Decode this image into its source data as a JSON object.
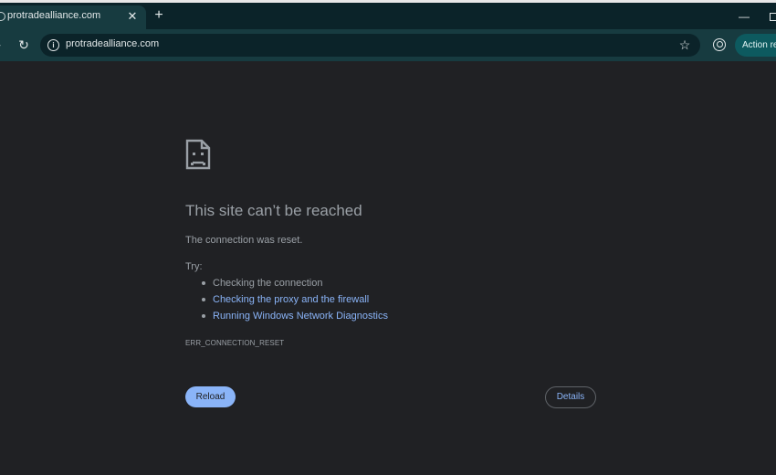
{
  "browser": {
    "tab": {
      "title": "protradealliance.com",
      "close_glyph": "✕"
    },
    "new_tab_glyph": "+",
    "window_controls": {
      "minimize_glyph": "—"
    },
    "toolbar": {
      "forward_glyph": "›",
      "reload_glyph": "↻",
      "url": "protradealliance.com",
      "site_info_glyph": "i",
      "bookmark_glyph": "☆",
      "action_button_label": "Action re"
    }
  },
  "error_page": {
    "headline": "This site can’t be reached",
    "description": "The connection was reset.",
    "try_label": "Try:",
    "suggestions": [
      {
        "text": "Checking the connection",
        "is_link": false
      },
      {
        "text": "Checking the proxy and the firewall",
        "is_link": true
      },
      {
        "text": "Running Windows Network Diagnostics",
        "is_link": true
      }
    ],
    "error_code": "ERR_CONNECTION_RESET",
    "reload_label": "Reload",
    "details_label": "Details"
  },
  "colors": {
    "page_background": "#202124",
    "tabstrip": "#0b2329",
    "toolbar": "#173b40",
    "text_secondary": "#9aa0a6",
    "link": "#8ab4f8",
    "primary_button": "#8ab4f8"
  },
  "icons": {
    "tab_favicon": "globe-icon",
    "error_icon": "sad-document-icon",
    "site_info": "info-icon",
    "bookmark": "star-icon",
    "profile": "profile-icon"
  }
}
